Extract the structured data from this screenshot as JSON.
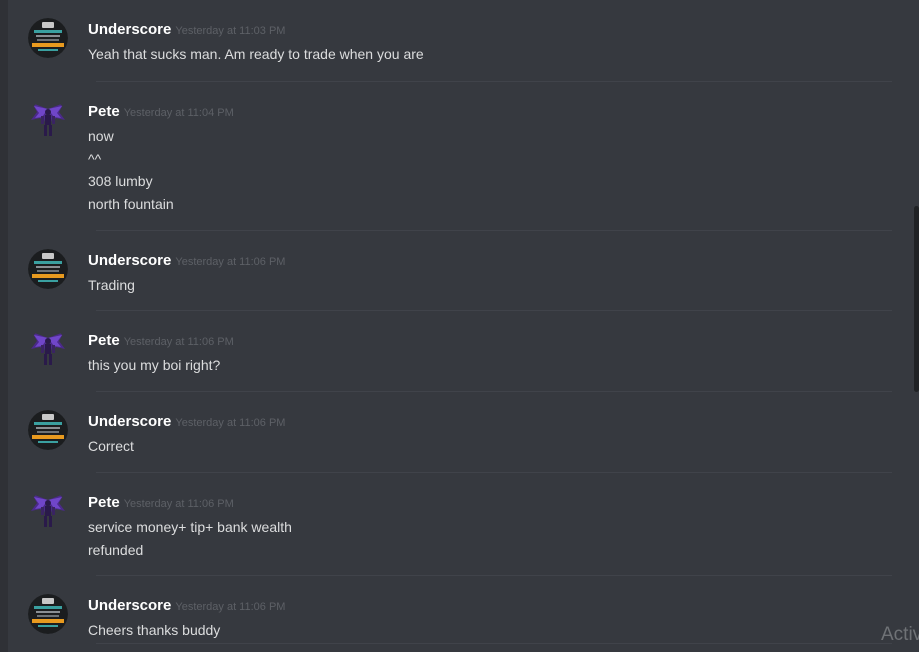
{
  "messages": [
    {
      "username": "Underscore",
      "timestamp": "Yesterday at 11:03 PM",
      "avatar": "underscore-runescape-avatar",
      "lines": [
        "Yeah that sucks man. Am ready to trade when you are"
      ]
    },
    {
      "username": "Pete",
      "timestamp": "Yesterday at 11:04 PM",
      "avatar": "pete-winged-demon-avatar",
      "lines": [
        "now",
        "^^",
        "308 lumby",
        "north fountain"
      ]
    },
    {
      "username": "Underscore",
      "timestamp": "Yesterday at 11:06 PM",
      "avatar": "underscore-runescape-avatar",
      "lines": [
        "Trading"
      ]
    },
    {
      "username": "Pete",
      "timestamp": "Yesterday at 11:06 PM",
      "avatar": "pete-winged-demon-avatar",
      "lines": [
        "this you my boi right?"
      ]
    },
    {
      "username": "Underscore",
      "timestamp": "Yesterday at 11:06 PM",
      "avatar": "underscore-runescape-avatar",
      "lines": [
        "Correct"
      ]
    },
    {
      "username": "Pete",
      "timestamp": "Yesterday at 11:06 PM",
      "avatar": "pete-winged-demon-avatar",
      "lines": [
        "service money+ tip+ bank wealth",
        "refunded"
      ]
    },
    {
      "username": "Underscore",
      "timestamp": "Yesterday at 11:06 PM",
      "avatar": "underscore-runescape-avatar",
      "lines": [
        "Cheers thanks buddy"
      ]
    }
  ],
  "watermark": "Activ",
  "colors": {
    "background": "#36393f",
    "username": "#ffffff",
    "timestamp": "#5d6066",
    "message_text": "#dcddde",
    "divider": "#40434a"
  }
}
